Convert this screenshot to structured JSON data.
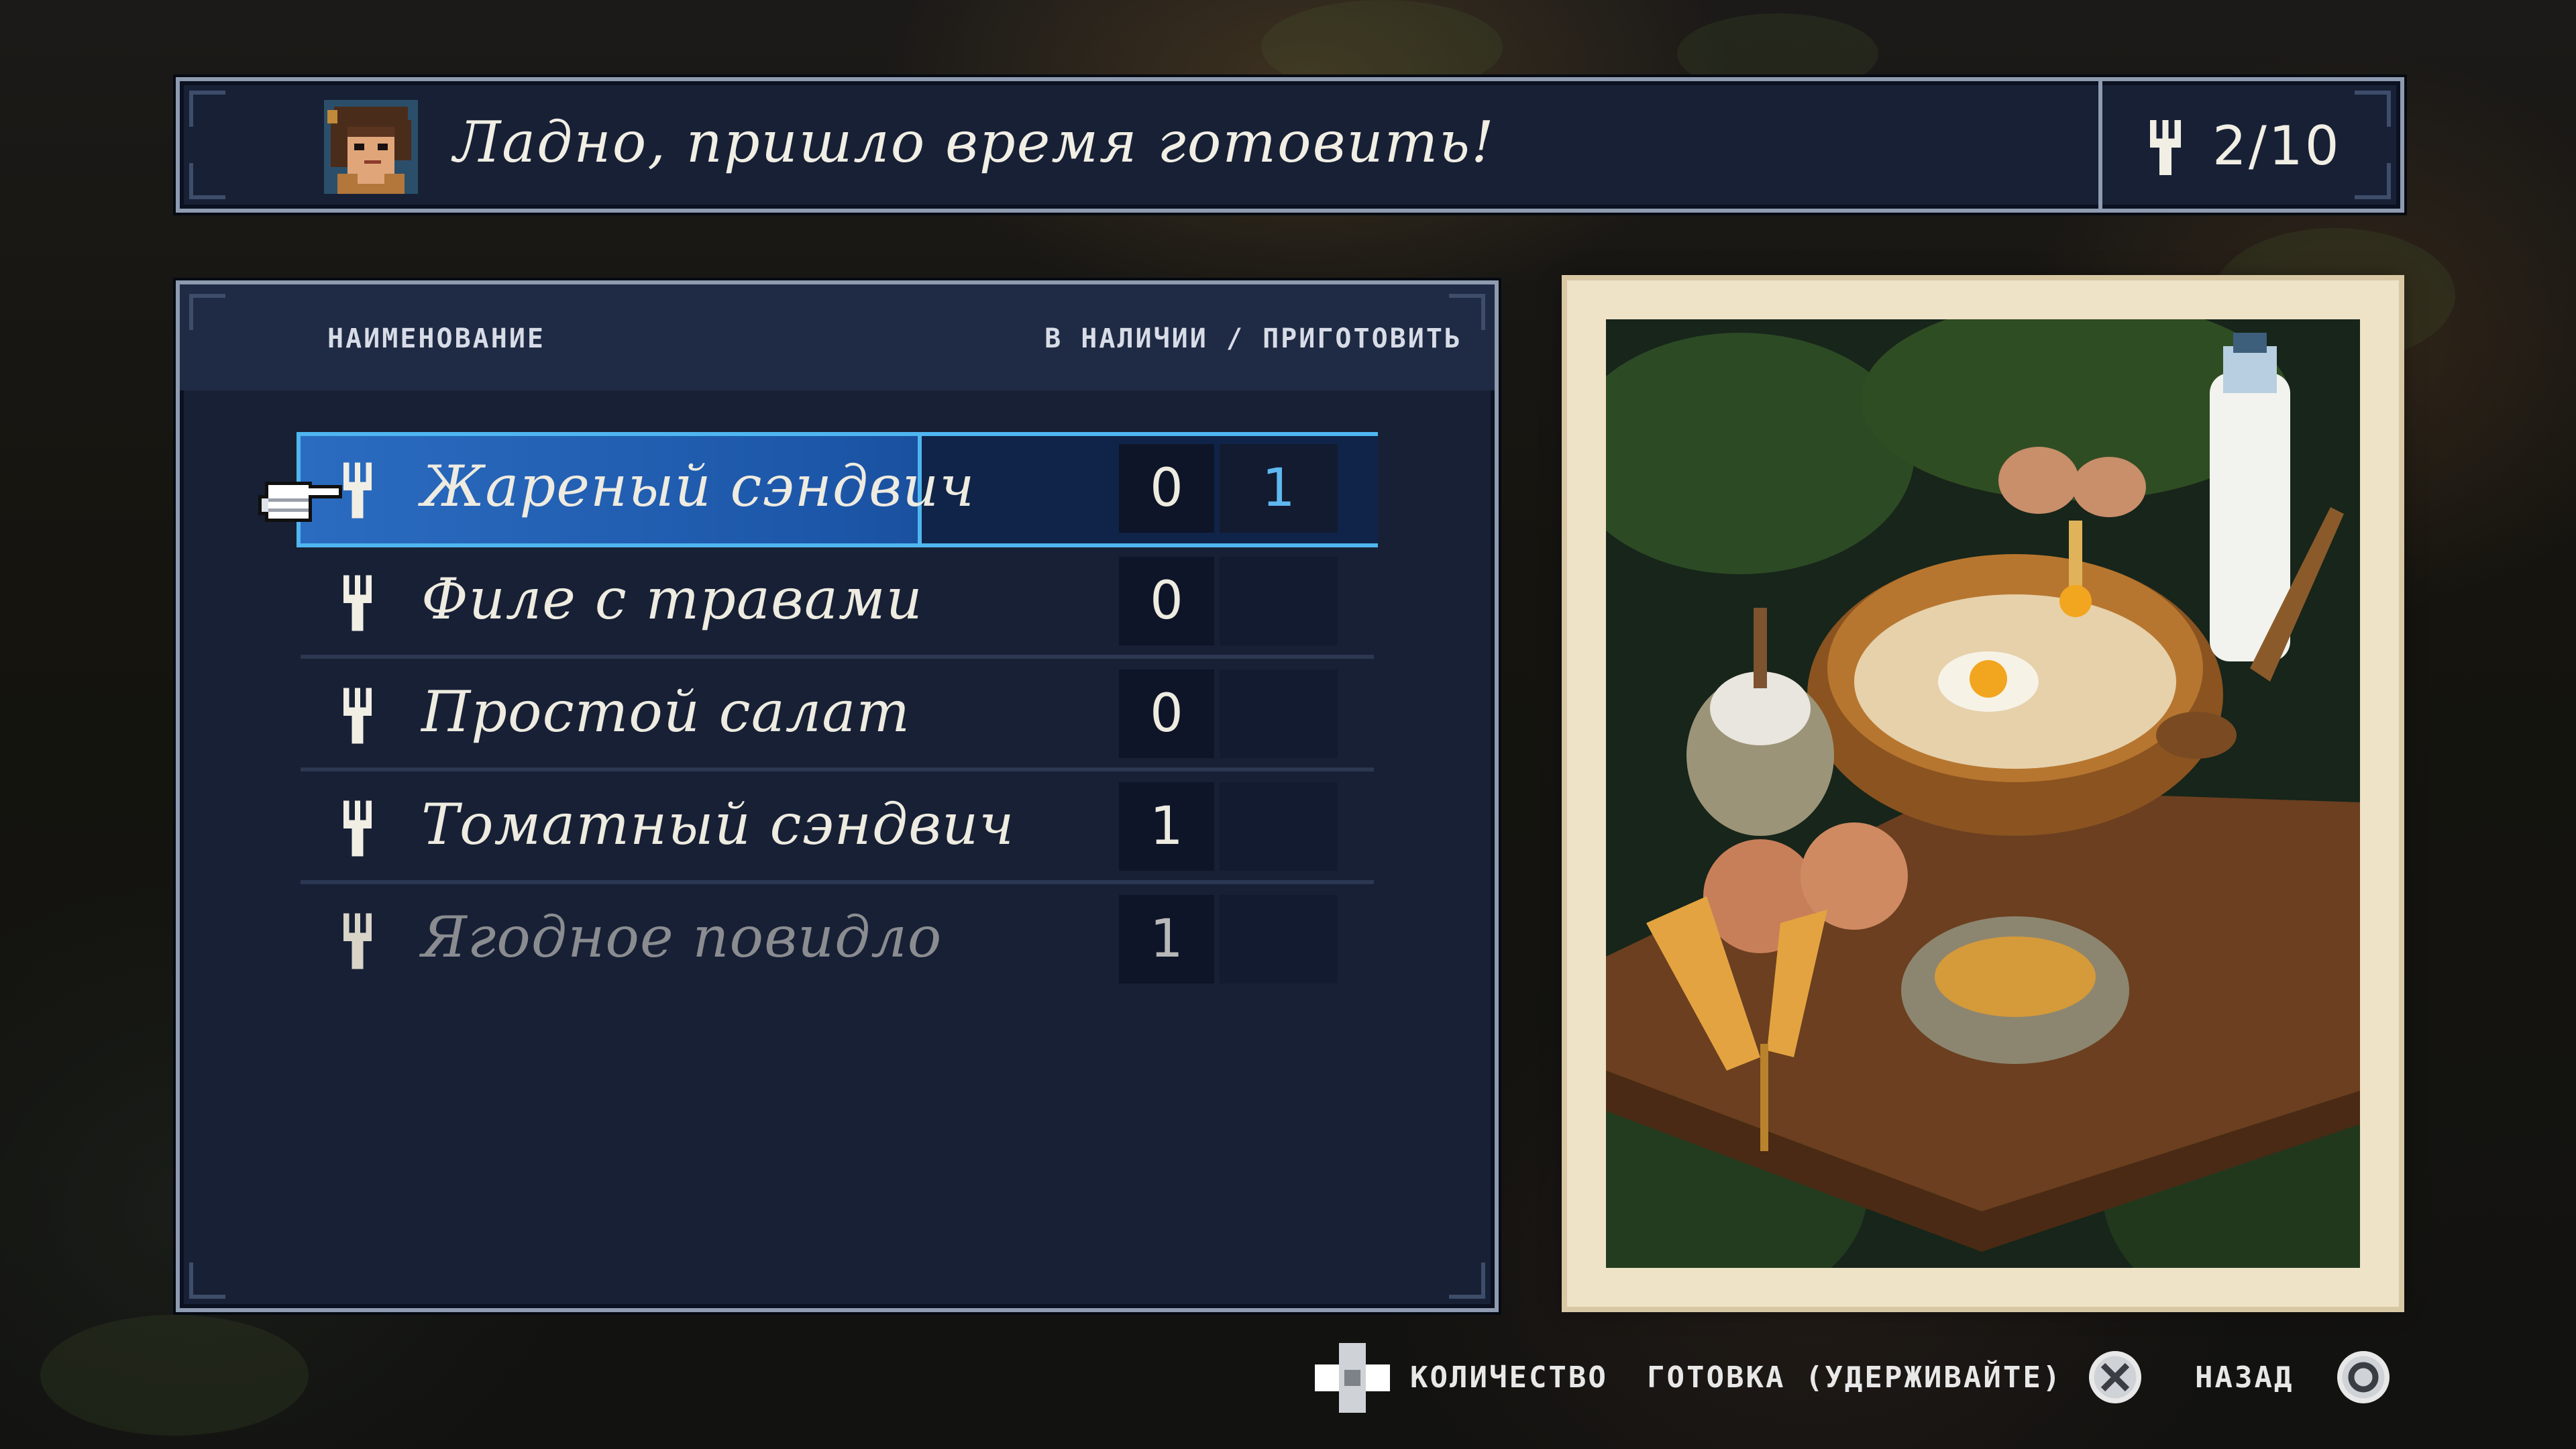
{
  "dialogue": {
    "text": "Ладно, пришло время готовить!",
    "portrait_icon": "character-portrait"
  },
  "counter": {
    "icon": "fork-icon",
    "text": "2/10"
  },
  "list": {
    "header_name": "НАИМЕНОВАНИЕ",
    "header_stock": "В НАЛИЧИИ / ПРИГОТОВИТЬ",
    "items": [
      {
        "name": "Жареный сэндвич",
        "stock": "0",
        "cook": "1",
        "selected": true,
        "disabled": false
      },
      {
        "name": "Филе с травами",
        "stock": "0",
        "cook": "",
        "selected": false,
        "disabled": false
      },
      {
        "name": "Простой салат",
        "stock": "0",
        "cook": "",
        "selected": false,
        "disabled": false
      },
      {
        "name": "Томатный сэндвич",
        "stock": "1",
        "cook": "",
        "selected": false,
        "disabled": false
      },
      {
        "name": "Ягодное повидло",
        "stock": "1",
        "cook": "",
        "selected": false,
        "disabled": true
      }
    ]
  },
  "controls": {
    "quantity_label": "КОЛИЧЕСТВО",
    "cook_label": "ГОТОВКА (УДЕРЖИВАЙТЕ)",
    "back_label": "НАЗАД",
    "quantity_icon": "dpad-icon",
    "cook_icon": "cross-button-icon",
    "back_icon": "circle-button-icon"
  },
  "colors": {
    "panel_bg": "#172035",
    "panel_border": "#8e9bb0",
    "selection": "#2b6cc0",
    "selection_outline": "#4fb6f0",
    "cook_value": "#5fb8f0",
    "card_bg": "#eee2c7"
  }
}
